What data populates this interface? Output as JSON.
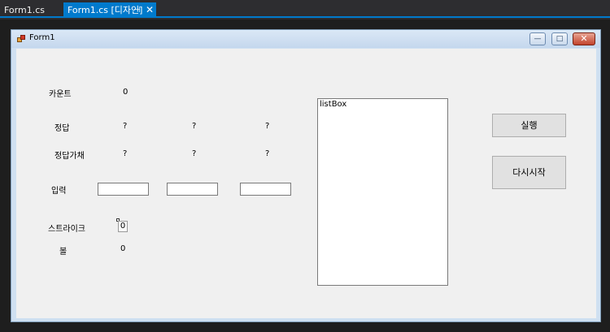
{
  "tabs": [
    {
      "label": "Form1.cs",
      "active": false
    },
    {
      "label": "Form1.cs [디자인]",
      "active": true
    }
  ],
  "tab_pin_glyph": "⊣",
  "tab_close_glyph": "✕",
  "form": {
    "title": "Form1",
    "window_buttons": {
      "minimize": "—",
      "maximize": "□",
      "close": "✕"
    }
  },
  "labels": {
    "count": "카운트",
    "count_value": "0",
    "answer": "정답",
    "answer_values": [
      "?",
      "?",
      "?"
    ],
    "answer_hidden": "정답가채",
    "answer_hidden_values": [
      "?",
      "?",
      "?"
    ],
    "input": "입력",
    "strike": "스트라이크",
    "strike_value": "0",
    "ball": "볼",
    "ball_value": "0"
  },
  "inputs": [
    {
      "value": "",
      "placeholder": ""
    },
    {
      "value": "",
      "placeholder": ""
    },
    {
      "value": "",
      "placeholder": ""
    }
  ],
  "listbox": {
    "text": "listBox"
  },
  "buttons": {
    "run": "실행",
    "restart": "다시시작"
  },
  "colors": {
    "accent": "#007acc",
    "ide_background": "#2d2d30",
    "form_client": "#f0f0f0"
  }
}
